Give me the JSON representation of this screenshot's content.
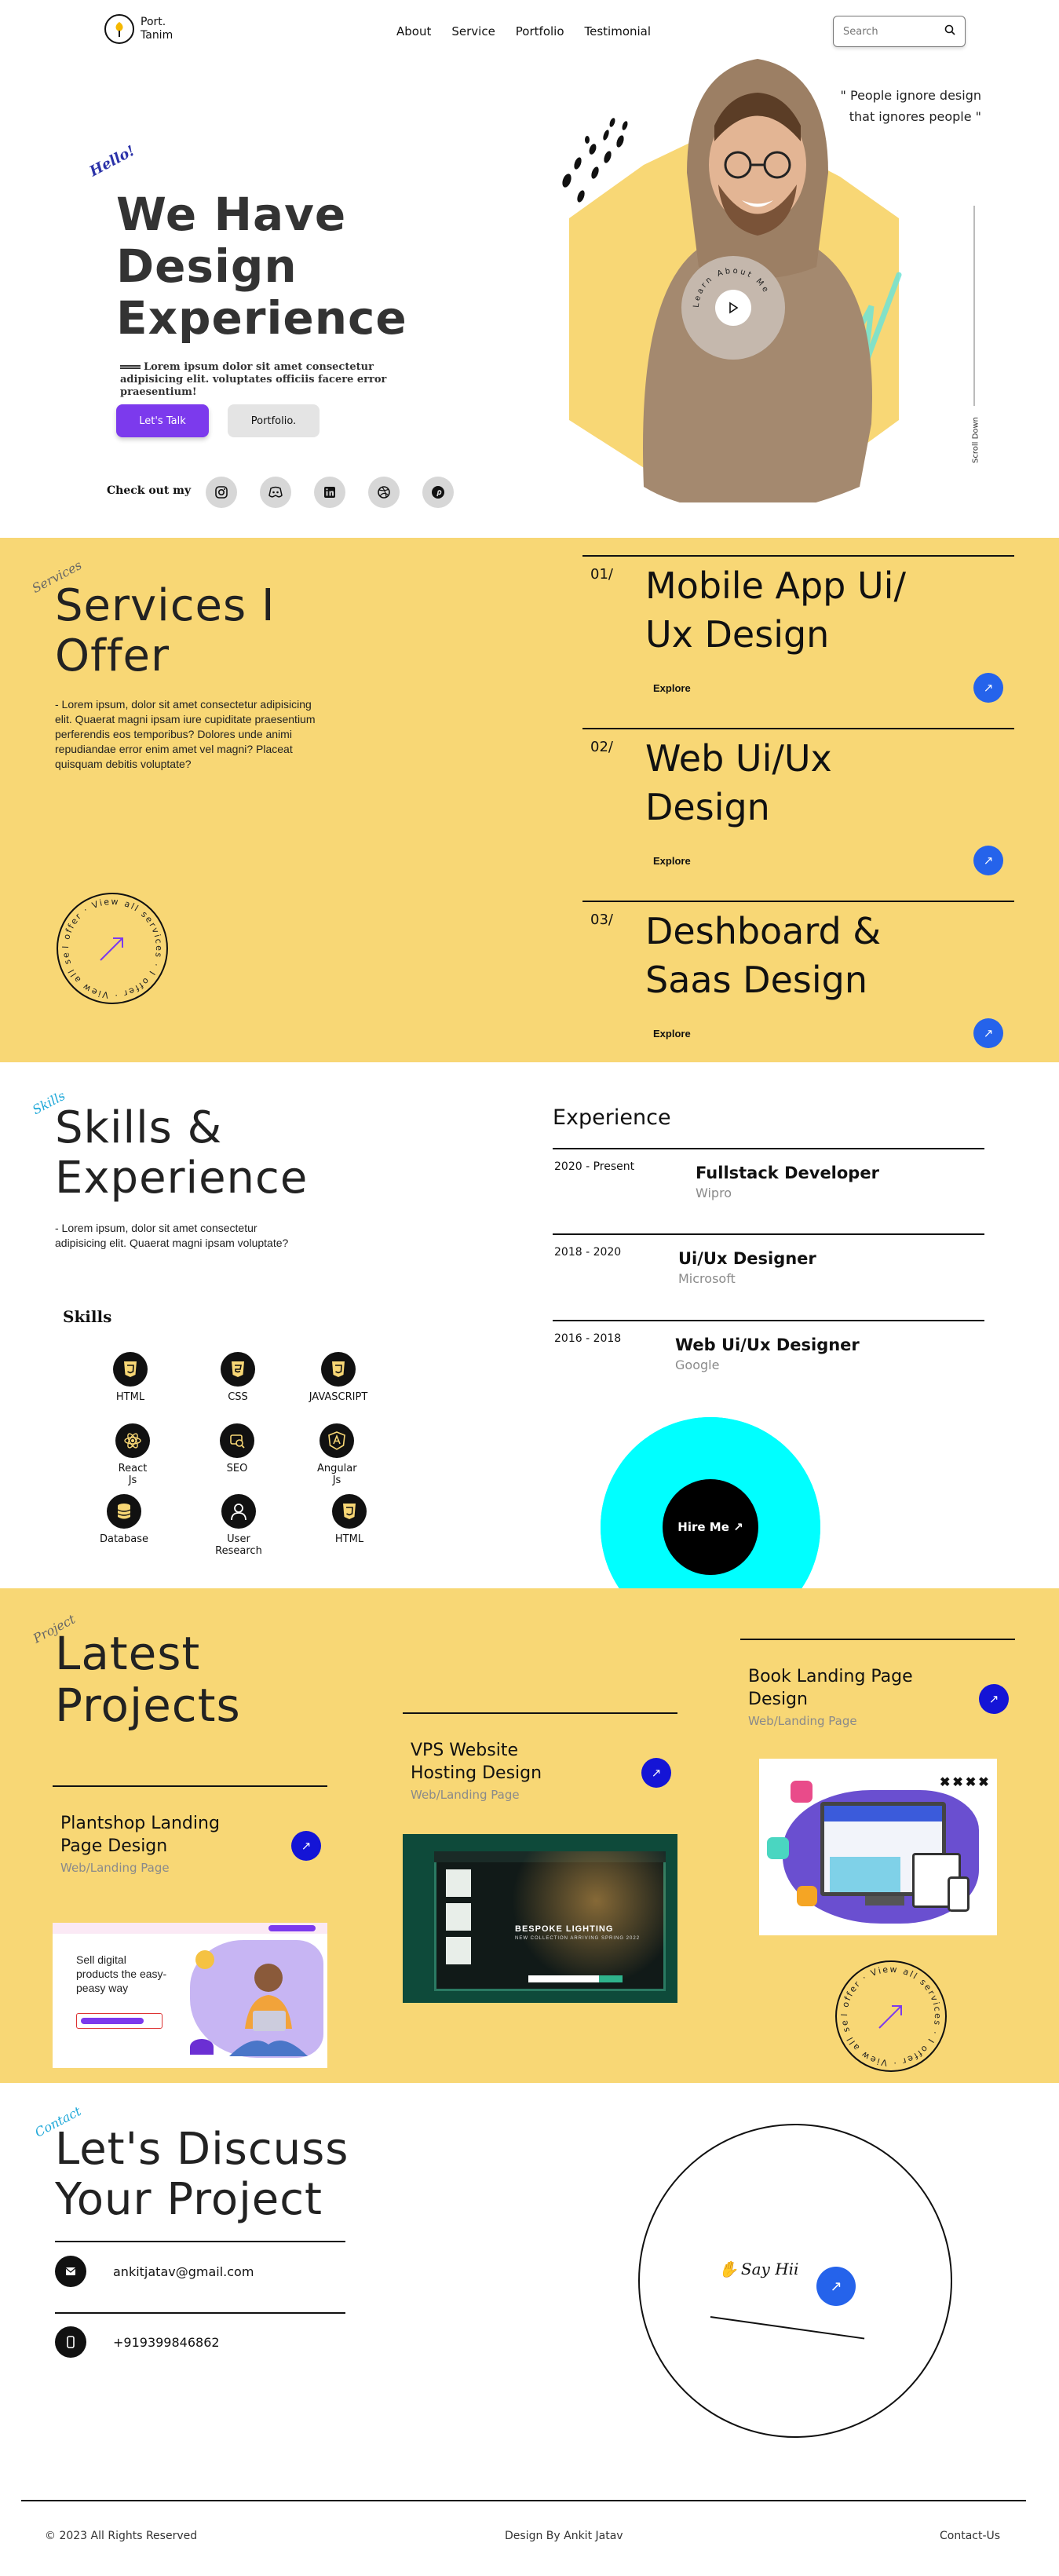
{
  "brand": {
    "line1": "Port.",
    "line2": "Tanim"
  },
  "nav": {
    "items": [
      "About",
      "Service",
      "Portfolio",
      "Testimonial"
    ]
  },
  "search": {
    "placeholder": "Search"
  },
  "hero": {
    "hello": "Hello!",
    "title_lines": [
      "We Have",
      "Design",
      "Experience"
    ],
    "desc": "Lorem ipsum dolor sit amet consectetur adipisicing elit. voluptates officiis facere error praesentium!",
    "talk_label": "Let's Talk",
    "portfolio_label": "Portfolio.",
    "checkout_label": "Check out my",
    "quote": "\" People ignore design that ignores people \"",
    "play_ring_text": "Learn About Me",
    "scroll_label": "Scroll Down",
    "socials": [
      "instagram-icon",
      "discord-icon",
      "linkedin-icon",
      "dribbble-icon",
      "pinterest-icon"
    ]
  },
  "services": {
    "tag": "Services",
    "title_lines": [
      "Services I",
      "Offer"
    ],
    "desc": "- Lorem ipsum, dolor sit amet consectetur adipisicing elit. Quaerat magni ipsam iure cupiditate praesentium perferendis eos temporibus? Dolores unde animi repudiandae error enim amet vel magni? Placeat quisquam debitis voluptate?",
    "badge_text": "I offer · View all services · I offer · View all services ·",
    "items": [
      {
        "num": "01/",
        "title_lines": [
          "Mobile App Ui/",
          "Ux Design"
        ],
        "link": "Explore"
      },
      {
        "num": "02/",
        "title_lines": [
          "Web Ui/Ux",
          "Design"
        ],
        "link": "Explore"
      },
      {
        "num": "03/",
        "title_lines": [
          "Deshboard &",
          "Saas Design"
        ],
        "link": "Explore"
      }
    ]
  },
  "skills": {
    "tag": "Skills",
    "title_lines": [
      "Skills &",
      "Experience"
    ],
    "desc": "- Lorem ipsum, dolor sit amet consectetur adipisicing elit. Quaerat magni ipsam voluptate?",
    "subtitle": "Skills",
    "items": [
      {
        "label": "HTML",
        "icon": "html5-icon"
      },
      {
        "label": "CSS",
        "icon": "css3-icon"
      },
      {
        "label": "JAVASCRIPT",
        "icon": "javascript-icon"
      },
      {
        "label": "React Js",
        "icon": "react-icon"
      },
      {
        "label": "SEO",
        "icon": "seo-icon"
      },
      {
        "label": "Angular Js",
        "icon": "angular-icon"
      },
      {
        "label": "Database",
        "icon": "database-icon"
      },
      {
        "label": "User Research",
        "icon": "user-icon"
      },
      {
        "label": "HTML",
        "icon": "html5-icon"
      }
    ],
    "experience_title": "Experience",
    "experience": [
      {
        "dates": "2020 - Present",
        "role": "Fullstack Developer",
        "company": "Wipro"
      },
      {
        "dates": "2018 - 2020",
        "role": "Ui/Ux Designer",
        "company": "Microsoft"
      },
      {
        "dates": "2016 - 2018",
        "role": "Web Ui/Ux Designer",
        "company": "Google"
      }
    ],
    "hire_label": "Hire Me"
  },
  "projects": {
    "tag": "Project",
    "title_lines": [
      "Latest",
      "Projects"
    ],
    "badge_text": "I offer · View all services · I offer · View all services ·",
    "items": [
      {
        "title_lines": [
          "Plantshop Landing",
          "Page Design"
        ],
        "category": "Web/Landing Page"
      },
      {
        "title_lines": [
          "VPS Website",
          "Hosting Design"
        ],
        "category": "Web/Landing Page"
      },
      {
        "title_lines": [
          "Book Landing Page",
          "Design"
        ],
        "category": "Web/Landing Page"
      }
    ],
    "thumb_plant": {
      "headline": "Sell digital products the easy-peasy way"
    },
    "thumb_vps": {
      "headline": "BESPOKE LIGHTING",
      "sub": "NEW COLLECTION ARRIVING SPRING 2022"
    }
  },
  "contact": {
    "tag": "Contact",
    "title_lines": [
      "Let's Discuss",
      "Your Project"
    ],
    "email": "ankitjatav@gmail.com",
    "phone": "+919399846862",
    "say_hi": "Say Hii"
  },
  "footer": {
    "copyright": "© 2023 All Rights Reserved",
    "credit": "Design By Ankit Jatav",
    "contact": "Contact-Us"
  },
  "colors": {
    "yellow": "#f8d775",
    "blue": "#2563eb",
    "purple": "#7c3aed",
    "cyan": "#00ffff"
  }
}
